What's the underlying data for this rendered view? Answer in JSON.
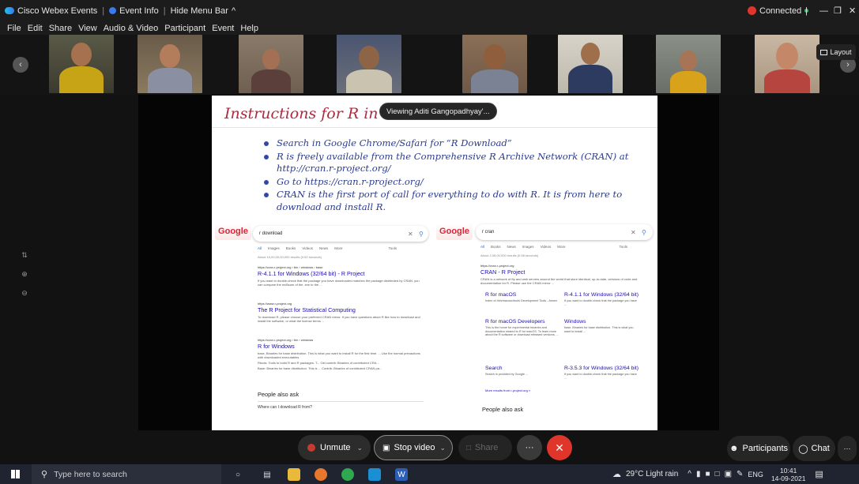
{
  "titlebar": {
    "app_name": "Cisco Webex Events",
    "event_info": "Event Info",
    "hide_menu_bar": "Hide Menu Bar",
    "connected": "Connected"
  },
  "menu": [
    "File",
    "Edit",
    "Share",
    "View",
    "Audio & Video",
    "Participant",
    "Event",
    "Help"
  ],
  "layout_label": "Layout",
  "viewing_badge": "Viewing Aditi Gangopadhyay'...",
  "slide": {
    "title": "Instructions for R in",
    "bullets": [
      "Search in Google Chrome/Safari for “R Download”",
      "R is freely available from the Comprehensive R Archive Network (CRAN) at http://cran.r-project.org/",
      "Go to https://cran.r-project.org/",
      "CRAN is the first port of call for everything to do with R. It is from here to download and install R."
    ]
  },
  "google_left": {
    "logo": "Google",
    "query": "r download",
    "tabs": [
      "All",
      "Images",
      "Books",
      "Videos",
      "News",
      "More",
      "Tools"
    ],
    "stats": "About 10,00,00,00,000 results (0.52 seconds)",
    "results": [
      {
        "url": "https://cran.r-project.org › bin › windows › base",
        "title": "R-4.1.1 for Windows (32/64 bit) - R Project",
        "snippet": "If you want to double-check that the package you have downloaded matches the package distributed by CRAN, you can compare the md5sum of the .exe to the ..."
      },
      {
        "url": "https://www.r-project.org",
        "title": "The R Project for Statistical Computing",
        "snippet": "To download R, please choose your preferred CRAN mirror. If you have questions about R like how to download and install the software, or what the license terms ..."
      },
      {
        "url": "https://cran.r-project.org › bin › windows",
        "title": "R for Windows",
        "snippet": "base, Binaries for base distribution. This is what you want to install R for the first time. ... Use the normal precautions with downloaded executables."
      }
    ],
    "extra_lines": [
      "Rtools: Tools to build R and R packages. T...   Old contrib: Binaries of contributed CRA...",
      "Base: Binaries for base distribution. This is ...   Contrib: Binaries of contributed CRAN pa..."
    ],
    "paa_title": "People also ask",
    "paa_question": "Where can I download R from?"
  },
  "google_right": {
    "logo": "Google",
    "query": "r cran",
    "tabs": [
      "All",
      "Books",
      "News",
      "Images",
      "Videos",
      "More",
      "Tools"
    ],
    "stats": "About 2,08,00,000 results (0.58 seconds)",
    "main": {
      "url": "https://cran.r-project.org",
      "title": "CRAN - R Project",
      "snippet": "CRAN is a network of ftp and web servers around the world that store identical, up-to-date, versions of code and documentation for R. Please use the CRAN mirror ..."
    },
    "sublinks": [
      {
        "title": "R for macOS",
        "snippet": "Index of /bin/macosx/tools Development Tools - Annex"
      },
      {
        "title": "R-4.1.1 for Windows (32/64 bit)",
        "snippet": "If you want to double-check that the package you have ..."
      },
      {
        "title": "R for macOS Developers",
        "snippet": "This is the home for experimental binaries and documentation related to R for macOS. To learn more about the R software or download released versions, ..."
      },
      {
        "title": "Windows",
        "snippet": "base, Binaries for base distribution. This is what you want to install ..."
      },
      {
        "title": "Search",
        "snippet": "Search is provided by Google ..."
      },
      {
        "title": "R-3.5.3 for Windows (32/64 bit)",
        "snippet": "If you want to double-check that the package you have ..."
      }
    ],
    "more_results": "More results from r-project.org »",
    "paa_title": "People also ask"
  },
  "controls": {
    "unmute": "Unmute",
    "stop_video": "Stop video",
    "share": "Share",
    "more": "···",
    "participants": "Participants",
    "chat": "Chat"
  },
  "taskbar": {
    "search_placeholder": "Type here to search",
    "weather": "29°C  Light rain",
    "lang": "ENG",
    "time": "10:41",
    "date": "14-09-2021"
  },
  "colors": {
    "accent_red": "#e0352b",
    "link_blue": "#1a0dab",
    "slide_title": "#b0293e",
    "slide_text": "#2a3b8f",
    "connected_green": "#2fbf6a"
  }
}
